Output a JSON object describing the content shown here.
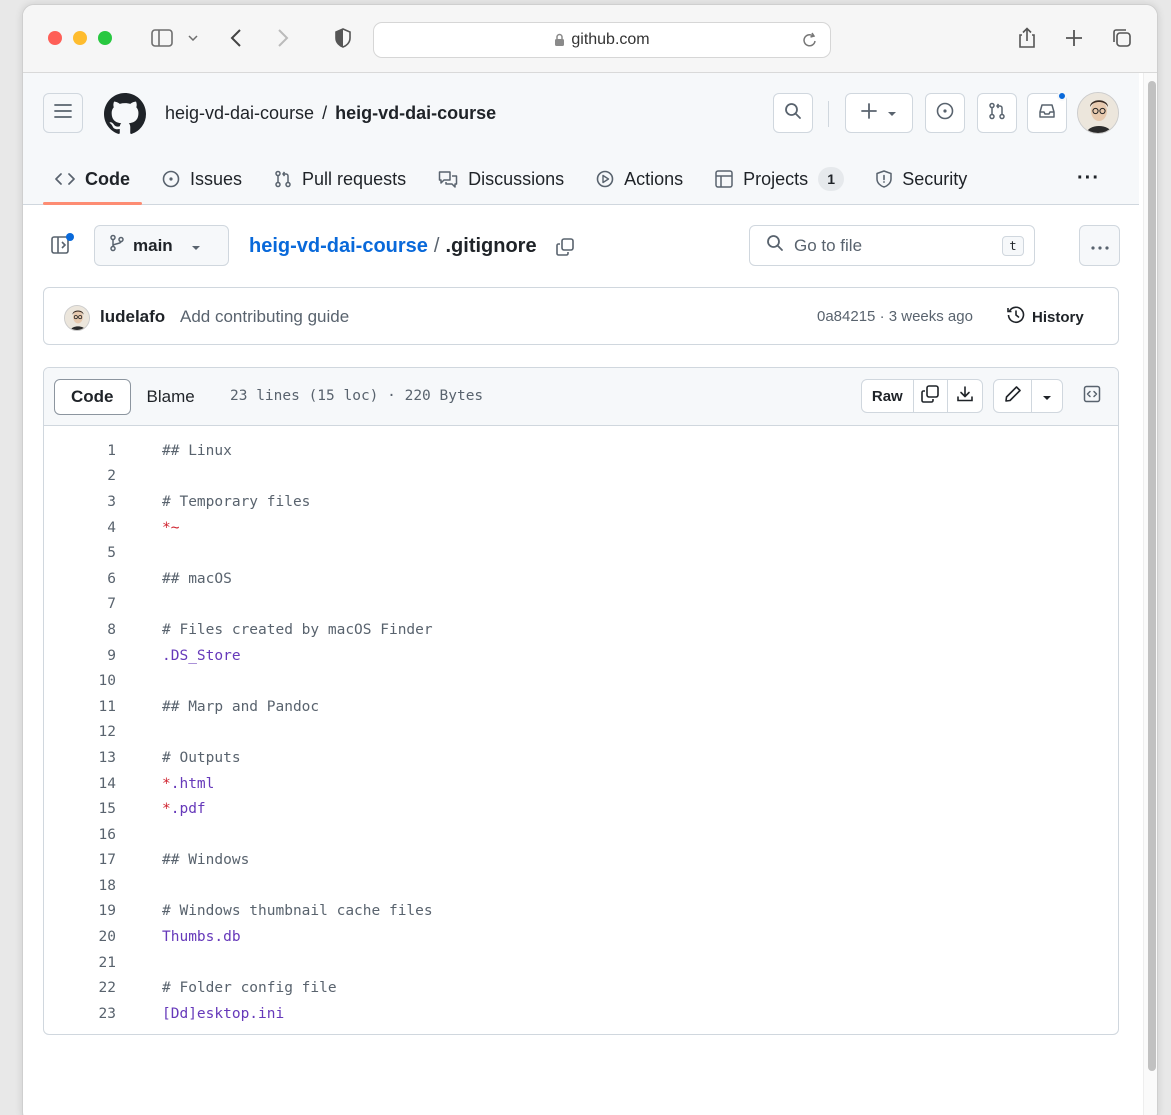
{
  "browser": {
    "url": "github.com"
  },
  "repo": {
    "owner": "heig-vd-dai-course",
    "separator": "/",
    "name": "heig-vd-dai-course"
  },
  "tabs": [
    {
      "label": "Code",
      "icon": "code-icon"
    },
    {
      "label": "Issues",
      "icon": "issue-icon"
    },
    {
      "label": "Pull requests",
      "icon": "pull-request-icon"
    },
    {
      "label": "Discussions",
      "icon": "discussion-icon"
    },
    {
      "label": "Actions",
      "icon": "play-icon"
    },
    {
      "label": "Projects",
      "icon": "table-icon",
      "counter": "1"
    },
    {
      "label": "Security",
      "icon": "shield-icon"
    }
  ],
  "more_label": "···",
  "file": {
    "branch": "main",
    "repo_crumb": "heig-vd-dai-course",
    "crumb_sep": "/",
    "filename": ".gitignore",
    "goto_placeholder": "Go to file",
    "goto_key": "t"
  },
  "commit": {
    "author": "ludelafo",
    "message": "Add contributing guide",
    "meta": "0a84215 · 3 weeks ago",
    "history_label": "History"
  },
  "code_header": {
    "tab_code": "Code",
    "tab_blame": "Blame",
    "info": "23 lines (15 loc) · 220 Bytes",
    "raw_label": "Raw"
  },
  "code_lines": [
    {
      "n": "1",
      "t": "## Linux",
      "k": "comment"
    },
    {
      "n": "2",
      "t": "",
      "k": "plain"
    },
    {
      "n": "3",
      "t": "# Temporary files",
      "k": "comment"
    },
    {
      "n": "4",
      "t": "*~",
      "k": "red"
    },
    {
      "n": "5",
      "t": "",
      "k": "plain"
    },
    {
      "n": "6",
      "t": "## macOS",
      "k": "comment"
    },
    {
      "n": "7",
      "t": "",
      "k": "plain"
    },
    {
      "n": "8",
      "t": "# Files created by macOS Finder",
      "k": "comment"
    },
    {
      "n": "9",
      "t": ".DS_Store",
      "k": "blue"
    },
    {
      "n": "10",
      "t": "",
      "k": "plain"
    },
    {
      "n": "11",
      "t": "## Marp and Pandoc",
      "k": "comment"
    },
    {
      "n": "12",
      "t": "",
      "k": "plain"
    },
    {
      "n": "13",
      "t": "# Outputs",
      "k": "comment"
    },
    {
      "n": "14",
      "t": "*.html",
      "k": "redblue"
    },
    {
      "n": "15",
      "t": "*.pdf",
      "k": "redblue"
    },
    {
      "n": "16",
      "t": "",
      "k": "plain"
    },
    {
      "n": "17",
      "t": "## Windows",
      "k": "comment"
    },
    {
      "n": "18",
      "t": "",
      "k": "plain"
    },
    {
      "n": "19",
      "t": "# Windows thumbnail cache files",
      "k": "comment"
    },
    {
      "n": "20",
      "t": "Thumbs.db",
      "k": "blue"
    },
    {
      "n": "21",
      "t": "",
      "k": "plain"
    },
    {
      "n": "22",
      "t": "# Folder config file",
      "k": "comment"
    },
    {
      "n": "23",
      "t": "[Dd]esktop.ini",
      "k": "brackets"
    }
  ],
  "colors": {
    "link": "#0969da",
    "tab_underline": "#fd8c73",
    "code_red": "#cf222e",
    "code_purple": "#6639ba",
    "notification": "#0969da"
  }
}
